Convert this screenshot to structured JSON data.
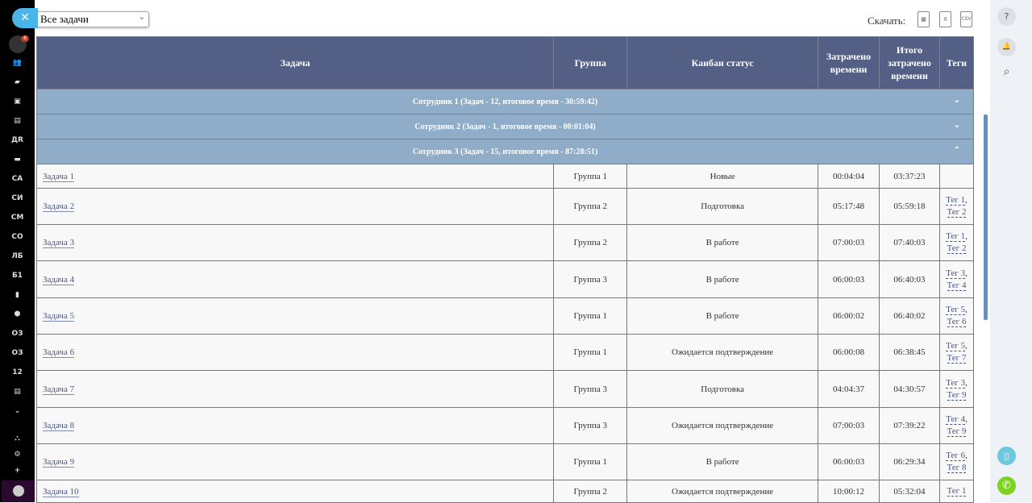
{
  "sidebar": {
    "items": [
      {
        "name": "users-icon",
        "label": "👥"
      },
      {
        "name": "chat-icon",
        "label": "▰"
      },
      {
        "name": "calendar-icon",
        "label": "▣"
      },
      {
        "name": "contacts-icon",
        "label": "▤"
      },
      {
        "name": "dr",
        "label": "ДR"
      },
      {
        "name": "drive-icon",
        "label": "▬"
      },
      {
        "name": "sa",
        "label": "СА"
      },
      {
        "name": "si",
        "label": "СИ"
      },
      {
        "name": "sm",
        "label": "СМ"
      },
      {
        "name": "so",
        "label": "СО"
      },
      {
        "name": "lb",
        "label": "ЛБ"
      },
      {
        "name": "b1",
        "label": "Б1"
      },
      {
        "name": "document-icon",
        "label": "▮"
      },
      {
        "name": "box-icon",
        "label": "⬢"
      },
      {
        "name": "oz1",
        "label": "ОЗ"
      },
      {
        "name": "oz2",
        "label": "ОЗ"
      },
      {
        "name": "n12",
        "label": "12"
      },
      {
        "name": "storage-icon",
        "label": "▤"
      },
      {
        "name": "more-icon",
        "label": "⌄"
      }
    ],
    "bottom": [
      {
        "name": "structure-icon",
        "label": "⛬"
      },
      {
        "name": "settings-icon",
        "label": "⚙"
      },
      {
        "name": "add-icon",
        "label": "+"
      }
    ],
    "badge": "8"
  },
  "filter": {
    "selected": "Все задачи"
  },
  "download": {
    "label": "Скачать:",
    "formats": [
      "▦",
      "X",
      "CSV"
    ]
  },
  "table": {
    "headers": [
      "Задача",
      "Группа",
      "Канбан статус",
      "Затрачено времени",
      "Итого затрачено времени",
      "Теги"
    ],
    "groups": [
      {
        "label": "Сотрудник 1 (Задач - 12, итоговое время - 30:59:42)",
        "expanded": false
      },
      {
        "label": "Сотрудник 2 (Задач - 1, итоговое время - 00:01:04)",
        "expanded": false
      },
      {
        "label": "Сотрудник 3 (Задач - 15, итоговое время - 87:28:51)",
        "expanded": true
      }
    ],
    "rows": [
      {
        "task": "Задача 1",
        "group": "Группа 1",
        "status": "Новые",
        "spent": "00:04:04",
        "total": "03:37:23",
        "tags": []
      },
      {
        "task": "Задача 2",
        "group": "Группа 2",
        "status": "Подготовка",
        "spent": "05:17:48",
        "total": "05:59:18",
        "tags": [
          "Тег 1",
          "Тег 2"
        ]
      },
      {
        "task": "Задача 3",
        "group": "Группа 2",
        "status": "В работе",
        "spent": "07:00:03",
        "total": "07:40:03",
        "tags": [
          "Тег 1",
          "Тег 2"
        ]
      },
      {
        "task": "Задача 4",
        "group": "Группа 3",
        "status": "В работе",
        "spent": "06:00:03",
        "total": "06:40:03",
        "tags": [
          "Тег 3",
          "Тег 4"
        ]
      },
      {
        "task": "Задача 5",
        "group": "Группа 1",
        "status": "В работе",
        "spent": "06:00:02",
        "total": "06:40:02",
        "tags": [
          "Тег 5",
          "Тег 6"
        ]
      },
      {
        "task": "Задача 6",
        "group": "Группа 1",
        "status": "Ожидается подтверждение",
        "spent": "06:00:08",
        "total": "06:38:45",
        "tags": [
          "Тег 5",
          "Тег 7"
        ]
      },
      {
        "task": "Задача 7",
        "group": "Группа 3",
        "status": "Подготовка",
        "spent": "04:04:37",
        "total": "04:30:57",
        "tags": [
          "Тег 3",
          "Тег 9"
        ]
      },
      {
        "task": "Задача 8",
        "group": "Группа 3",
        "status": "Ожидается подтверждение",
        "spent": "07:00:03",
        "total": "07:39:22",
        "tags": [
          "Тег 4",
          "Тег 9"
        ]
      },
      {
        "task": "Задача 9",
        "group": "Группа 1",
        "status": "В работе",
        "spent": "06:00:03",
        "total": "06:29:34",
        "tags": [
          "Тег 6",
          "Тег 8"
        ]
      },
      {
        "task": "Задача 10",
        "group": "Группа 2",
        "status": "Ожидается подтверждение",
        "spent": "10:00:12",
        "total": "05:32:04",
        "tags": [
          "Тег 1"
        ]
      }
    ]
  },
  "right_panel": {
    "help": "?",
    "bell": "🔔",
    "search": "⌕",
    "mobile": "▯",
    "phone": "✆"
  },
  "colors": {
    "header": "#535f85",
    "group_row": "#8facc9",
    "accent": "#4ab5e8",
    "phone": "#7ed321",
    "mobile": "#6cc9e0"
  }
}
